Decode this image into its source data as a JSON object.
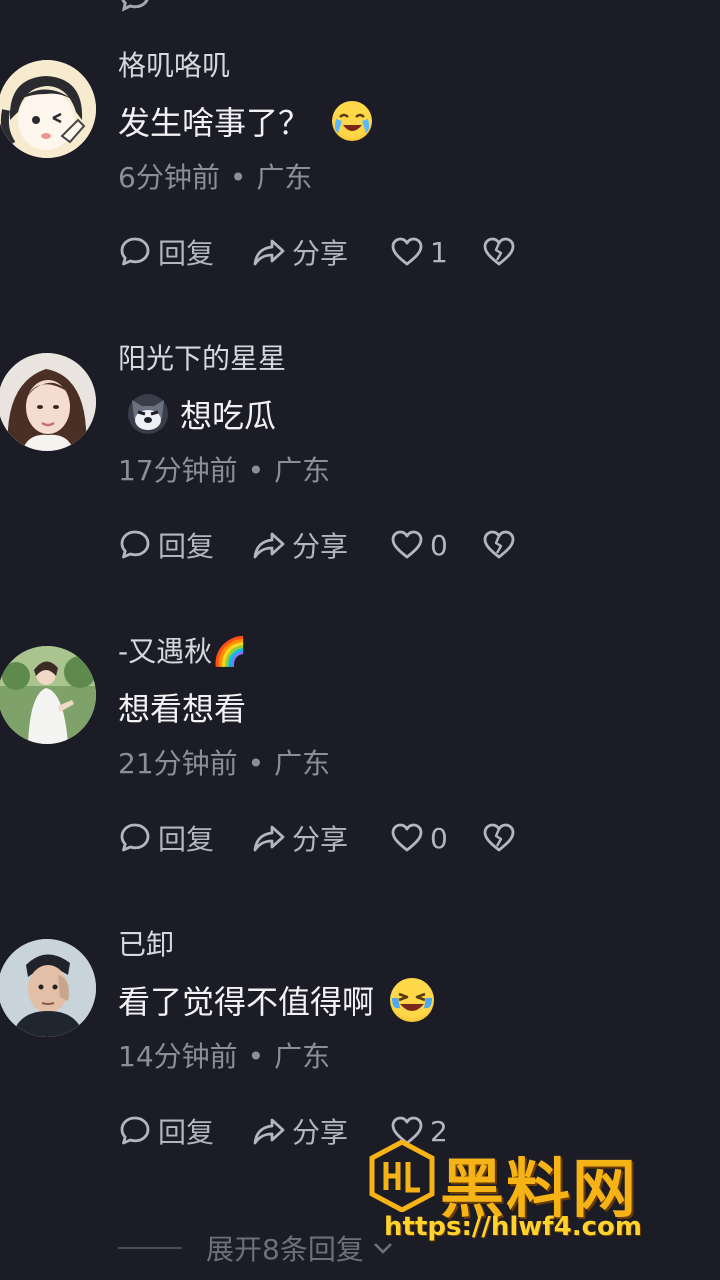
{
  "comments": [
    {
      "username": "格叽咯叽",
      "text": "发生啥事了？",
      "emoji": "crying-laugh-emoji",
      "time": "6分钟前",
      "location": "广东",
      "reply_label": "回复",
      "share_label": "分享",
      "likes": "1"
    },
    {
      "username": "阳光下的星星",
      "text": "想吃瓜",
      "emoji": "husky-dog-emoji",
      "time": "17分钟前",
      "location": "广东",
      "reply_label": "回复",
      "share_label": "分享",
      "likes": "0"
    },
    {
      "username": "-又遇秋🌈",
      "text": "想看想看",
      "time": "21分钟前",
      "location": "广东",
      "reply_label": "回复",
      "share_label": "分享",
      "likes": "0"
    },
    {
      "username": "已卸",
      "text": "看了觉得不值得啊",
      "emoji": "tears-of-joy-emoji",
      "time": "14分钟前",
      "location": "广东",
      "reply_label": "回复",
      "share_label": "分享",
      "likes": "2"
    }
  ],
  "expand_replies": "展开8条回复",
  "watermark": {
    "title": "黑料网",
    "url": "https://hlwf4.com"
  },
  "colors": {
    "background": "#1b1c26",
    "watermark": "#f5b316"
  }
}
